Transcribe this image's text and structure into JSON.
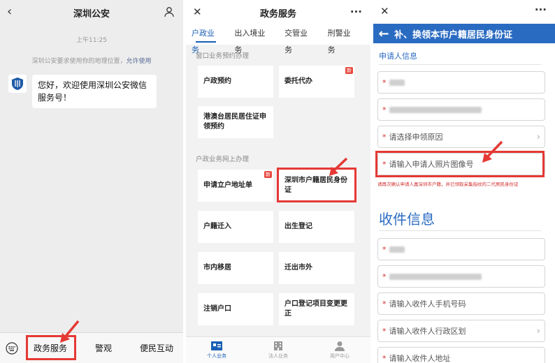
{
  "panel1": {
    "title": "深圳公安",
    "back_icon": "chevron-left-icon",
    "profile_icon": "person-icon",
    "time": "上午11:25",
    "location_notice": "深圳公安要求使用你的地理位置，",
    "location_allow": "允许使用",
    "message": "您好，欢迎使用深圳公安微信服务号！",
    "bottom_menu": [
      "政务服务",
      "警观",
      "便民互动"
    ]
  },
  "panel2": {
    "title": "政务服务",
    "tabs": [
      "户政业务",
      "出入境业务",
      "交管业务",
      "刑警业务"
    ],
    "active_tab": "户政业务",
    "section1": "窗口业务预约办理",
    "section1_items": [
      "户政预约",
      "委托代办",
      "港澳台居民居住证申领预约"
    ],
    "section2": "户政业务网上办理",
    "section2_items": [
      "申请立户地址单",
      "深圳市户籍居民身份证",
      "户籍迁入",
      "出生登记",
      "市内移居",
      "迁出市外",
      "注销户口",
      "户口登记项目变更更正"
    ],
    "new_badge": "新",
    "bottom_nav": [
      "个人业务",
      "法人业务",
      "用户中心"
    ]
  },
  "panel3": {
    "header_title": "补、换领本市户籍居民身份证",
    "applicant_section": "申请人信息",
    "reason_placeholder": "请选择申领原因",
    "photo_placeholder": "请输入申请人照片图像号",
    "note": "请再次确认申请人属深圳市户籍，并已领取采集指纹的二代居民身份证",
    "delivery_section": "收件信息",
    "phone_placeholder": "请输入收件人手机号码",
    "district_placeholder": "请输入收件人行政区划",
    "address_placeholder": "请输入收件人地址"
  },
  "colors": {
    "accent": "#2a6bc2",
    "highlight": "#e53935",
    "required": "#d32f2f"
  }
}
